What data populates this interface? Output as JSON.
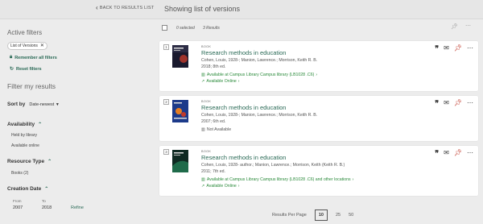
{
  "header": {
    "back_label": "BACK TO RESULTS LIST",
    "page_title": "Showing list of versions"
  },
  "sidebar": {
    "active_filters_heading": "Active filters",
    "chip_label": "List of Versions",
    "remember_label": "Remember all filters",
    "reset_label": "Reset filters",
    "filter_heading": "Filter my results",
    "sort_label": "Sort by",
    "sort_value": "Date-newest",
    "availability": {
      "heading": "Availability",
      "items": [
        "Held by library",
        "Available online"
      ]
    },
    "resource_type": {
      "heading": "Resource Type",
      "items": [
        "Books (2)"
      ]
    },
    "creation_date": {
      "heading": "Creation Date",
      "from_label": "From",
      "to_label": "To",
      "from_value": "2007",
      "to_value": "2018",
      "refine_label": "Refine"
    }
  },
  "results_bar": {
    "selected": "0 selected",
    "count": "3 Results"
  },
  "records": [
    {
      "number": "1",
      "type": "BOOK",
      "title": "Research methods in education",
      "authors": "Cohen, Louis, 1928-; Manion, Lawrence.; Morrison, Keith R. B.",
      "edition": "2018; 8th ed.",
      "availability": "Available at Campus Library  Campus library (LB1028 .C6)",
      "online": "Available Online",
      "cover_color": "#1a1a2e"
    },
    {
      "number": "2",
      "type": "BOOK",
      "title": "Research methods in education",
      "authors": "Cohen, Louis, 1928-; Manion, Lawrence.; Morrison, Keith R. B.",
      "edition": "2007; 6th ed.",
      "availability": "Not Available",
      "cover_color": "#1c3a8a"
    },
    {
      "number": "3",
      "type": "BOOK",
      "title": "Research methods in education",
      "authors": "Cohen, Louis, 1928- author.; Manion, Lawrence.; Morrison, Keith (Keith R. B.)",
      "edition": "2011; 7th ed.",
      "availability": "Available at Campus Library  Campus library (LB1028 .C6) and other locations",
      "online": "Available Online",
      "cover_color": "#0f2a22"
    }
  ],
  "pager": {
    "label": "Results Per Page",
    "options": [
      "10",
      "25",
      "50"
    ],
    "selected": "10"
  },
  "colors": {
    "accent": "#2a6a56",
    "available": "#2a8a3a",
    "pin": "#c0392b"
  }
}
